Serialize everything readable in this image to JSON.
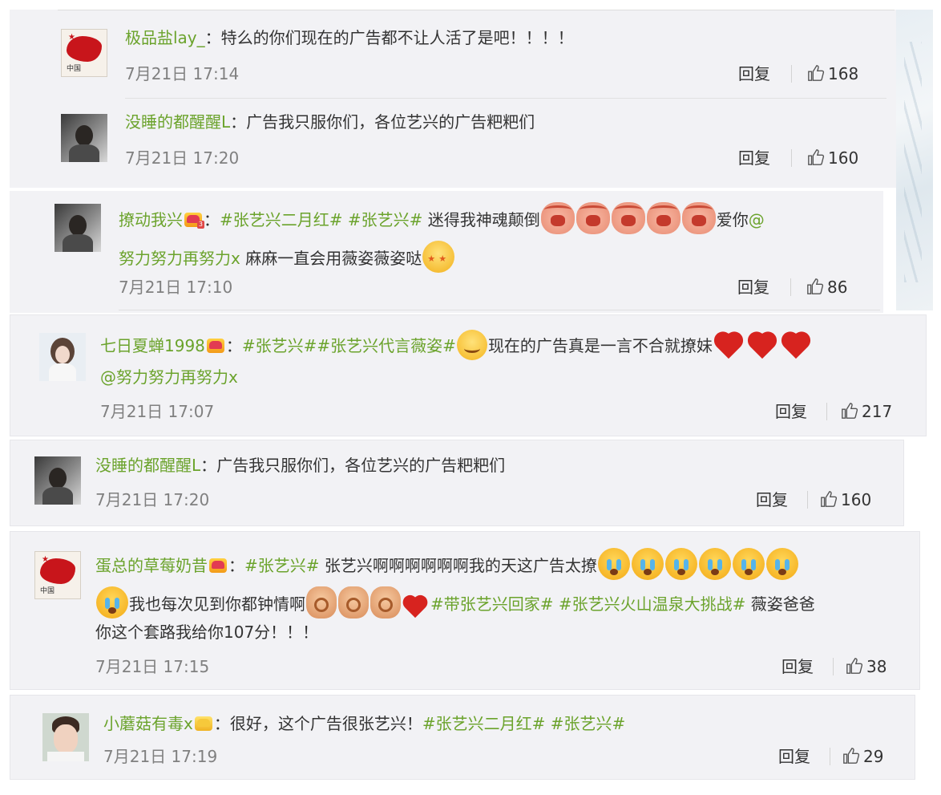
{
  "comments": [
    {
      "username": "极品盐lay_",
      "segments": [
        "特么的你们现在的广告都不让人活了是吧！！！！"
      ],
      "time": "7月21日 17:14",
      "reply": "回复",
      "likes": "168"
    },
    {
      "username": "没睡的都醒醒L",
      "segments": [
        "广告我只服你们，各位艺兴的广告粑粑们"
      ],
      "time": "7月21日 17:20",
      "reply": "回复",
      "likes": "160"
    },
    {
      "username": "撩动我兴",
      "segments": [
        "#张艺兴二月红#",
        "#张艺兴#",
        "迷得我神魂颠倒",
        "爱你",
        "@",
        "努力努力再努力x",
        "麻麻一直会用薇姿薇姿哒"
      ],
      "time": "7月21日 17:10",
      "reply": "回复",
      "likes": "86"
    },
    {
      "username": "七日夏蝉1998",
      "segments": [
        "#张艺兴##张艺兴代言薇姿#",
        "现在的广告真是一言不合就撩妹",
        "@努力努力再努力x"
      ],
      "time": "7月21日 17:07",
      "reply": "回复",
      "likes": "217"
    },
    {
      "username": "没睡的都醒醒L",
      "segments": [
        "广告我只服你们，各位艺兴的广告粑粑们"
      ],
      "time": "7月21日 17:20",
      "reply": "回复",
      "likes": "160"
    },
    {
      "username": "蛋总的草莓奶昔",
      "segments": [
        "#张艺兴#",
        "张艺兴啊啊啊啊啊啊我的天这广告太撩",
        "我也每次见到你都钟情啊",
        "#带张艺兴回家#",
        "#张艺兴火山温泉大挑战#",
        "薇姿爸爸",
        "你这个套路我给你107分！！！"
      ],
      "time": "7月21日 17:15",
      "reply": "回复",
      "likes": "38"
    },
    {
      "username": "小蘑菇有毒x",
      "segments": [
        "很好，这个广告很张艺兴！",
        "#张艺兴二月红#",
        "#张艺兴#"
      ],
      "time": "7月21日 17:19",
      "reply": "回复",
      "likes": "29"
    }
  ],
  "icons": {
    "like": "thumbs-up-icon",
    "member_badge": "crown-badge-icon",
    "vip_badge": "vip-badge-icon",
    "member_level": "3"
  },
  "avatar_captions": {
    "china_map": "中国"
  },
  "colors": {
    "link_green": "#6ba32c",
    "card_bg": "#f2f2f5",
    "time_gray": "#808080"
  }
}
